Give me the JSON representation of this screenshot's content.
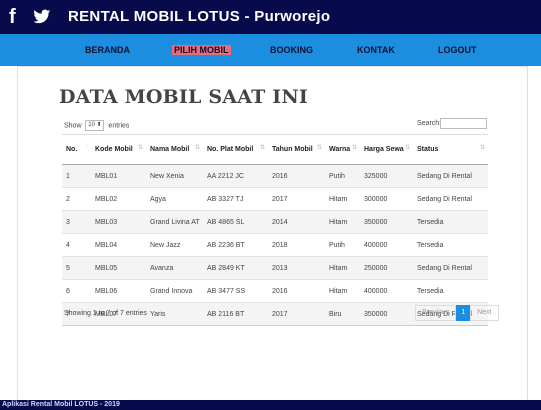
{
  "header": {
    "title": "RENTAL MOBIL LOTUS - Purworejo",
    "facebook_icon": "facebook-icon",
    "twitter_icon": "twitter-icon",
    "colors": {
      "header_bg": "#070b4c",
      "nav_bg": "#1c8ee0",
      "active_nav_bg": "#e86b78"
    }
  },
  "nav": {
    "items": [
      {
        "label": "BERANDA"
      },
      {
        "label": "PILIH MOBIL",
        "active": true
      },
      {
        "label": "BOOKING"
      },
      {
        "label": "KONTAK"
      },
      {
        "label": "LOGOUT"
      }
    ]
  },
  "main": {
    "heading": "DATA MOBIL SAAT INI",
    "show_prefix": "Show",
    "page_length": "10",
    "show_suffix": "entries",
    "search_label": "Search:",
    "search_value": ""
  },
  "table": {
    "columns": [
      "No.",
      "Kode Mobil",
      "Nama Mobil",
      "No. Plat Mobil",
      "Tahun Mobil",
      "Warna",
      "Harga Sewa",
      "Status"
    ],
    "rows": [
      [
        "1",
        "MBL01",
        "New Xenia",
        "AA 2212 JC",
        "2016",
        "Putih",
        "325000",
        "Sedang Di Rental"
      ],
      [
        "2",
        "MBL02",
        "Agya",
        "AB 3327 TJ",
        "2017",
        "Hitam",
        "300000",
        "Sedang Di Rental"
      ],
      [
        "3",
        "MBL03",
        "Grand Livina AT",
        "AB 4865 SL",
        "2014",
        "Hitam",
        "350000",
        "Tersedia"
      ],
      [
        "4",
        "MBL04",
        "New Jazz",
        "AB 2236 BT",
        "2018",
        "Putih",
        "400000",
        "Tersedia"
      ],
      [
        "5",
        "MBL05",
        "Avanza",
        "AB 2849 KT",
        "2013",
        "Hitam",
        "250000",
        "Sedang Di Rental"
      ],
      [
        "6",
        "MBL06",
        "Grand Innova",
        "AB 3477 SS",
        "2016",
        "Hitam",
        "400000",
        "Tersedia"
      ],
      [
        "7",
        "MBL07",
        "Yaris",
        "AB 2116 BT",
        "2017",
        "Biru",
        "350000",
        "Sedang Di Rental"
      ]
    ]
  },
  "info": "Showing 1 to 7 of 7 entries",
  "pagination": {
    "previous": "Previous",
    "current": "1",
    "next": "Next"
  },
  "footer": {
    "text": "Aplikasi Rental Mobil LOTUS - 2019"
  }
}
